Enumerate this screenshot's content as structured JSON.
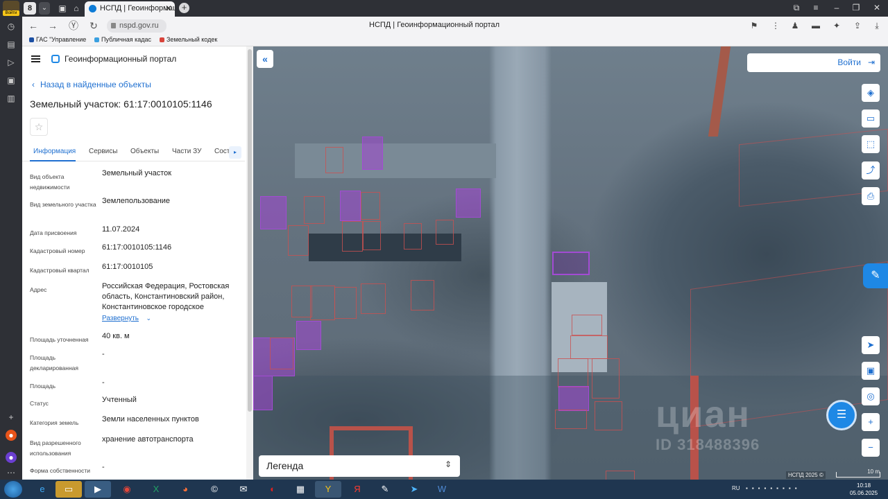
{
  "browser": {
    "avatar_label": "Войти",
    "tab_count": "8",
    "active_tab_title": "НСПД | Геоинформацио",
    "url": "nspd.gov.ru",
    "page_title": "НСПД | Геоинформационный портал",
    "bookmarks": [
      "ГАС \"Управление",
      "Публичная кадас",
      "Земельный кодек"
    ]
  },
  "panel": {
    "brand": "Геоинформационный портал",
    "back_link": "Назад в найденные объекты",
    "title": "Земельный участок: 61:17:0010105:1146",
    "tabs": [
      "Информация",
      "Сервисы",
      "Объекты",
      "Части ЗУ",
      "Сост"
    ],
    "expand_label": "Развернуть",
    "properties": [
      {
        "key": "Вид объекта недвижимости",
        "value": "Земельный участок"
      },
      {
        "key": "Вид земельного участка",
        "value": "Землепользование"
      },
      {
        "key": "Дата присвоения",
        "value": "11.07.2024"
      },
      {
        "key": "Кадастровый номер",
        "value": "61:17:0010105:1146"
      },
      {
        "key": "Кадастровый квартал",
        "value": "61:17:0010105"
      },
      {
        "key": "Адрес",
        "value": "Российская Федерация, Ростовская область, Константиновский район, Константиновское городское"
      },
      {
        "key": "Площадь уточненная",
        "value": "40 кв. м"
      },
      {
        "key": "Площадь декларированная",
        "value": "-"
      },
      {
        "key": "Площадь",
        "value": "-"
      },
      {
        "key": "Статус",
        "value": "Учтенный"
      },
      {
        "key": "Категория земель",
        "value": "Земли населенных пунктов"
      },
      {
        "key": "Вид разрешенного использования",
        "value": "хранение автотранспорта"
      },
      {
        "key": "Форма собственности",
        "value": "-"
      }
    ]
  },
  "map": {
    "login_label": "Войти",
    "legend_label": "Легенда",
    "watermark_brand": "циан",
    "watermark_id": "ID 318488396",
    "copyright": "НСПД 2025 ©",
    "scale_label": "10 m"
  },
  "taskbar": {
    "lang": "RU",
    "time": "10:18",
    "date": "05.06.2025"
  },
  "colors": {
    "accent": "#1e6fd0",
    "parcel_selected": "#a34bd4",
    "parcel_border": "#cc5050"
  }
}
